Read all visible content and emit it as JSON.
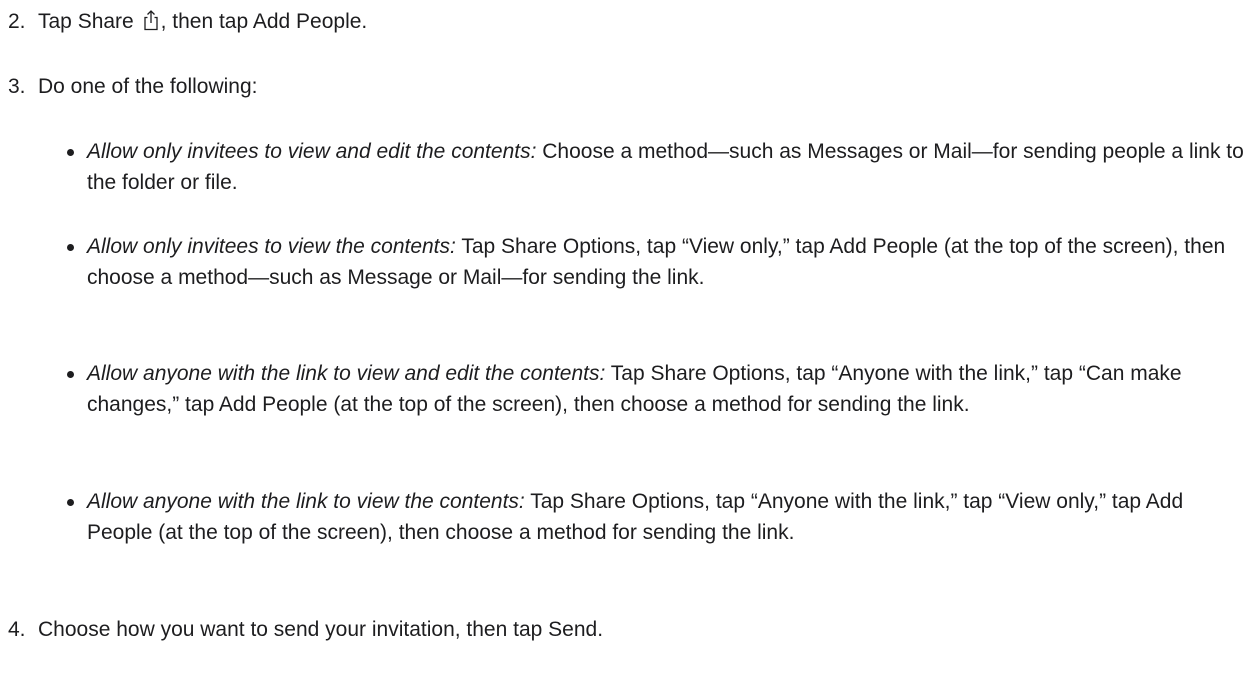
{
  "steps": [
    {
      "number": "2.",
      "before_icon": "Tap Share",
      "icon": "share-icon",
      "after_icon": ", then tap Add People."
    },
    {
      "number": "3.",
      "text": "Do one of the following:"
    },
    {
      "number": "4.",
      "text": "Choose how you want to send your invitation, then tap Send."
    }
  ],
  "options": [
    {
      "lead": "Allow only invitees to view and edit the contents:",
      "text": "Choose a method—such as Messages or Mail—for sending people a link to the folder or file."
    },
    {
      "lead": "Allow only invitees to view the contents:",
      "text": "Tap Share Options, tap “View only,” tap Add People (at the top of the screen), then choose a method—such as Message or Mail—for sending the link."
    },
    {
      "lead": "Allow anyone with the link to view and edit the contents:",
      "text": "Tap Share Options, tap “Anyone with the link,” tap “Can make changes,” tap Add People (at the top of the screen), then choose a method for sending the link."
    },
    {
      "lead": "Allow anyone with the link to view the contents:",
      "text": "Tap Share Options, tap “Anyone with the link,” tap “View only,” tap Add People (at the top of the screen), then choose a method for sending the link."
    }
  ]
}
